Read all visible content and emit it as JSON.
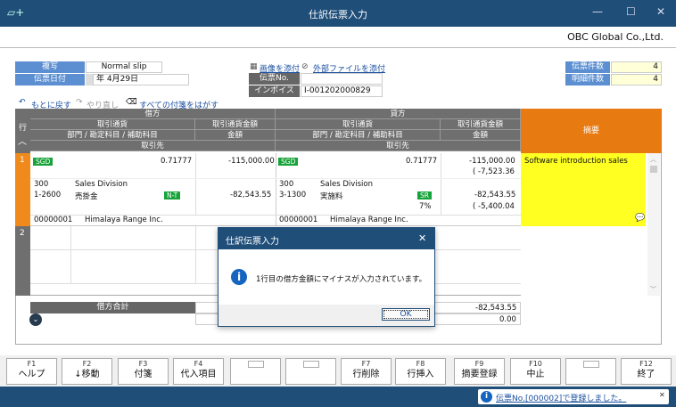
{
  "window": {
    "title": "仕訳伝票入力",
    "min": "—",
    "max": "☐",
    "close": "✕",
    "app_icon": "ticket-plus-icon"
  },
  "company": "OBC Global Co.,Ltd.",
  "header": {
    "copy_label": "複写",
    "slip_type": "Normal slip",
    "date_label": "伝票日付",
    "date_value": "年  4月29日",
    "attach_image": "画像を添付",
    "attach_file": "外部ファイルを添付",
    "slip_no_label": "伝票No.",
    "slip_no_value": "",
    "invoice_label": "インボイスNo.",
    "invoice_value": "I-001202000829",
    "slip_count_label": "伝票件数",
    "slip_count_value": "4",
    "detail_count_label": "明細件数",
    "detail_count_value": "4"
  },
  "toolbar": {
    "undo": "もとに戻す",
    "redo": "やり直し",
    "remove_tags": "すべての付箋をはがす"
  },
  "grid": {
    "row_header": "行",
    "debit": "借方",
    "credit": "貸方",
    "txn_currency": "取引通貨",
    "txn_amount": "取引通貨金額",
    "dept_account": "部門 / 勘定科目 / 補助科目",
    "amount": "金額",
    "partner": "取引先",
    "summary": "摘要",
    "rows": [
      {
        "no": "1",
        "d_currency": "SGD",
        "d_rate": "0.71777",
        "d_txn_amount": "-115,000.00",
        "d_dept_code": "300",
        "d_dept_name": "Sales Division",
        "d_acct_code": "1-2600",
        "d_acct_name": "売掛金",
        "d_tax": "N-T",
        "d_amount": "-82,543.55",
        "d_partner_code": "00000001",
        "d_partner_name": "Himalaya Range Inc.",
        "c_currency": "SGD",
        "c_rate": "0.71777",
        "c_txn_amount": "-115,000.00",
        "c_txn_sub": "( -7,523.36",
        "c_dept_code": "300",
        "c_dept_name": "Sales Division",
        "c_acct_code": "3-1300",
        "c_acct_name": "実施料",
        "c_tax": "SR",
        "c_amount": "-82,543.55",
        "c_rate_pct": "7%",
        "c_amount_sub": "( -5,400.04",
        "c_partner_code": "00000001",
        "c_partner_name": "Himalaya Range Inc.",
        "summary": "Software introduction sales"
      },
      {
        "no": "2"
      }
    ],
    "debit_total_label": "借方合計",
    "credit_total": "-82,543.55",
    "diff": "0.00"
  },
  "dialog": {
    "title": "仕訳伝票入力",
    "message": "1行目の借方金額にマイナスが入力されています。",
    "ok": "OK",
    "close": "✕"
  },
  "fkeys": [
    {
      "key": "F1",
      "label": "ヘルプ"
    },
    {
      "key": "F2",
      "label": "↓移動"
    },
    {
      "key": "F3",
      "label": "付箋"
    },
    {
      "key": "F4",
      "label": "代入項目"
    },
    {
      "key": "",
      "label": ""
    },
    {
      "key": "",
      "label": ""
    },
    {
      "key": "F7",
      "label": "行削除"
    },
    {
      "key": "F8",
      "label": "行挿入"
    },
    {
      "key": "F9",
      "label": "摘要登録"
    },
    {
      "key": "F10",
      "label": "中止"
    },
    {
      "key": "",
      "label": ""
    },
    {
      "key": "F12",
      "label": "終了"
    }
  ],
  "status_message": "伝票No.[000002]で登録しました。"
}
